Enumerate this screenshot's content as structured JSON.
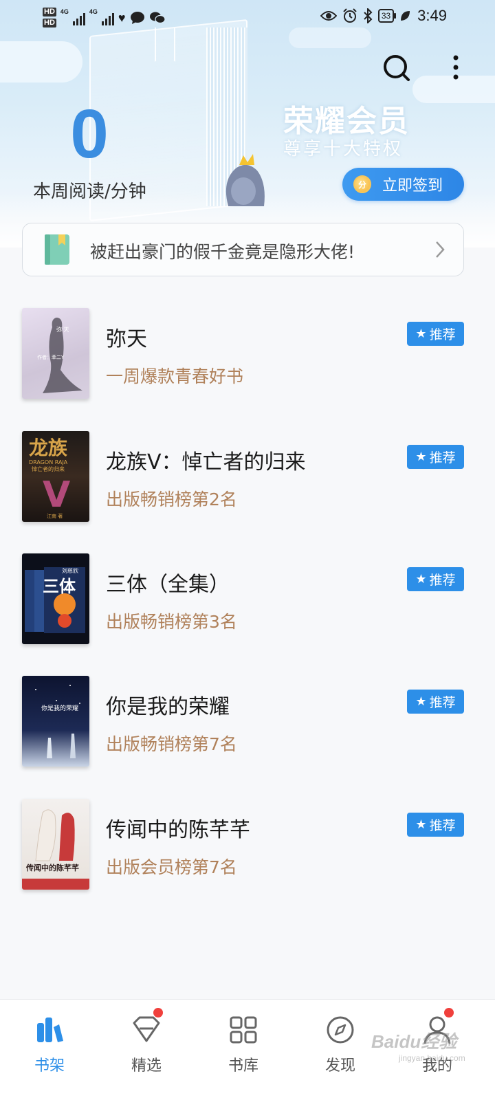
{
  "statusbar": {
    "hd1": "HD",
    "hd2": "HD",
    "net1": "4G",
    "net2": "4G",
    "battery": "33",
    "time": "3:49"
  },
  "header": {
    "read_count": "0",
    "read_label": "本周阅读/分钟",
    "vip_title": "荣耀会员",
    "vip_subtitle": "尊享十大特权",
    "signin_label": "立即签到",
    "coin_glyph": "分"
  },
  "banner": {
    "text": "被赶出豪门的假千金竟是隐形大佬!"
  },
  "books": [
    {
      "title": "弥天",
      "subtitle": "一周爆款青春好书",
      "badge": "推荐"
    },
    {
      "title": "龙族V：悼亡者的归来",
      "subtitle": "出版畅销榜第2名",
      "badge": "推荐"
    },
    {
      "title": "三体（全集）",
      "subtitle": "出版畅销榜第3名",
      "badge": "推荐"
    },
    {
      "title": "你是我的荣耀",
      "subtitle": "出版畅销榜第7名",
      "badge": "推荐"
    },
    {
      "title": "传闻中的陈芊芊",
      "subtitle": "出版会员榜第7名",
      "badge": "推荐"
    }
  ],
  "covers": {
    "cover1_line1": "弥 天",
    "cover1_line2": "作者：苯二Y",
    "cover2_title": "龙族",
    "cover2_en": "DRAGON RAJA",
    "cover2_sub": "悼亡者的归来",
    "cover2_letter": "V",
    "cover2_author": "江南 著",
    "cover3_title": "三体",
    "cover3_author": "刘慈欣",
    "cover4_title": "你是我的荣耀",
    "cover5_title": "传闻中的陈芊芊"
  },
  "nav": [
    {
      "label": "书架",
      "active": true
    },
    {
      "label": "精选",
      "dot": true
    },
    {
      "label": "书库"
    },
    {
      "label": "发现"
    },
    {
      "label": "我的",
      "dot": true
    }
  ],
  "watermark": {
    "brand": "Baidu经验",
    "url": "jingyan.baidu.com"
  },
  "colors": {
    "accent": "#2d8fe8",
    "subtitle": "#b0815a",
    "badge_dot": "#f0403c"
  }
}
